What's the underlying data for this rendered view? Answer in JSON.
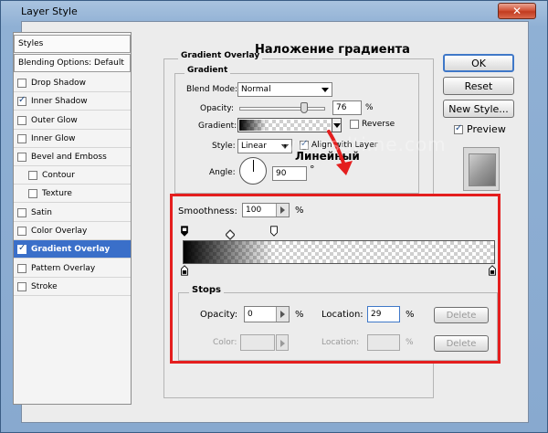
{
  "window": {
    "title": "Layer Style",
    "close_glyph": "✕"
  },
  "left_panel": {
    "items": [
      {
        "label": "Styles",
        "header": true
      },
      {
        "label": "Blending Options: Default",
        "header": true
      },
      {
        "label": "Drop Shadow",
        "checked": false
      },
      {
        "label": "Inner Shadow",
        "checked": true
      },
      {
        "label": "Outer Glow",
        "checked": false
      },
      {
        "label": "Inner Glow",
        "checked": false
      },
      {
        "label": "Bevel and Emboss",
        "checked": false
      },
      {
        "label": "Contour",
        "checked": false,
        "indent": true
      },
      {
        "label": "Texture",
        "checked": false,
        "indent": true
      },
      {
        "label": "Satin",
        "checked": false
      },
      {
        "label": "Color Overlay",
        "checked": false
      },
      {
        "label": "Gradient Overlay",
        "checked": true,
        "selected": true
      },
      {
        "label": "Pattern Overlay",
        "checked": false
      },
      {
        "label": "Stroke",
        "checked": false
      }
    ]
  },
  "buttons": {
    "ok": "OK",
    "reset": "Reset",
    "new_style": "New Style...",
    "preview_label": "Preview",
    "preview_checked": true
  },
  "gradient_overlay": {
    "section_title": "Gradient Overlay",
    "group_title": "Gradient",
    "blend_mode_label": "Blend Mode:",
    "blend_mode_value": "Normal",
    "opacity_label": "Opacity:",
    "opacity_value": "76",
    "opacity_slider": 0.76,
    "percent": "%",
    "gradient_label": "Gradient:",
    "reverse_label": "Reverse",
    "style_label": "Style:",
    "style_value": "Linear",
    "align_label": "Align with Layer",
    "angle_label": "Angle:",
    "angle_value": "90",
    "degree": "°"
  },
  "annotations": {
    "heading": "Наложение градиента",
    "linear": "Линейный",
    "arrow_color": "#e41e1e",
    "watermark": "www.psdtime.com"
  },
  "gradient_editor": {
    "smoothness_label": "Smoothness:",
    "smoothness_value": "100",
    "percent": "%",
    "stops_title": "Stops",
    "opacity_label": "Opacity:",
    "opacity_value": "0",
    "location_label": "Location:",
    "location_value": "29",
    "delete_label": "Delete",
    "color_label": "Color:",
    "color_location_label": "Location:",
    "highlight_color": "#e41e1e"
  }
}
